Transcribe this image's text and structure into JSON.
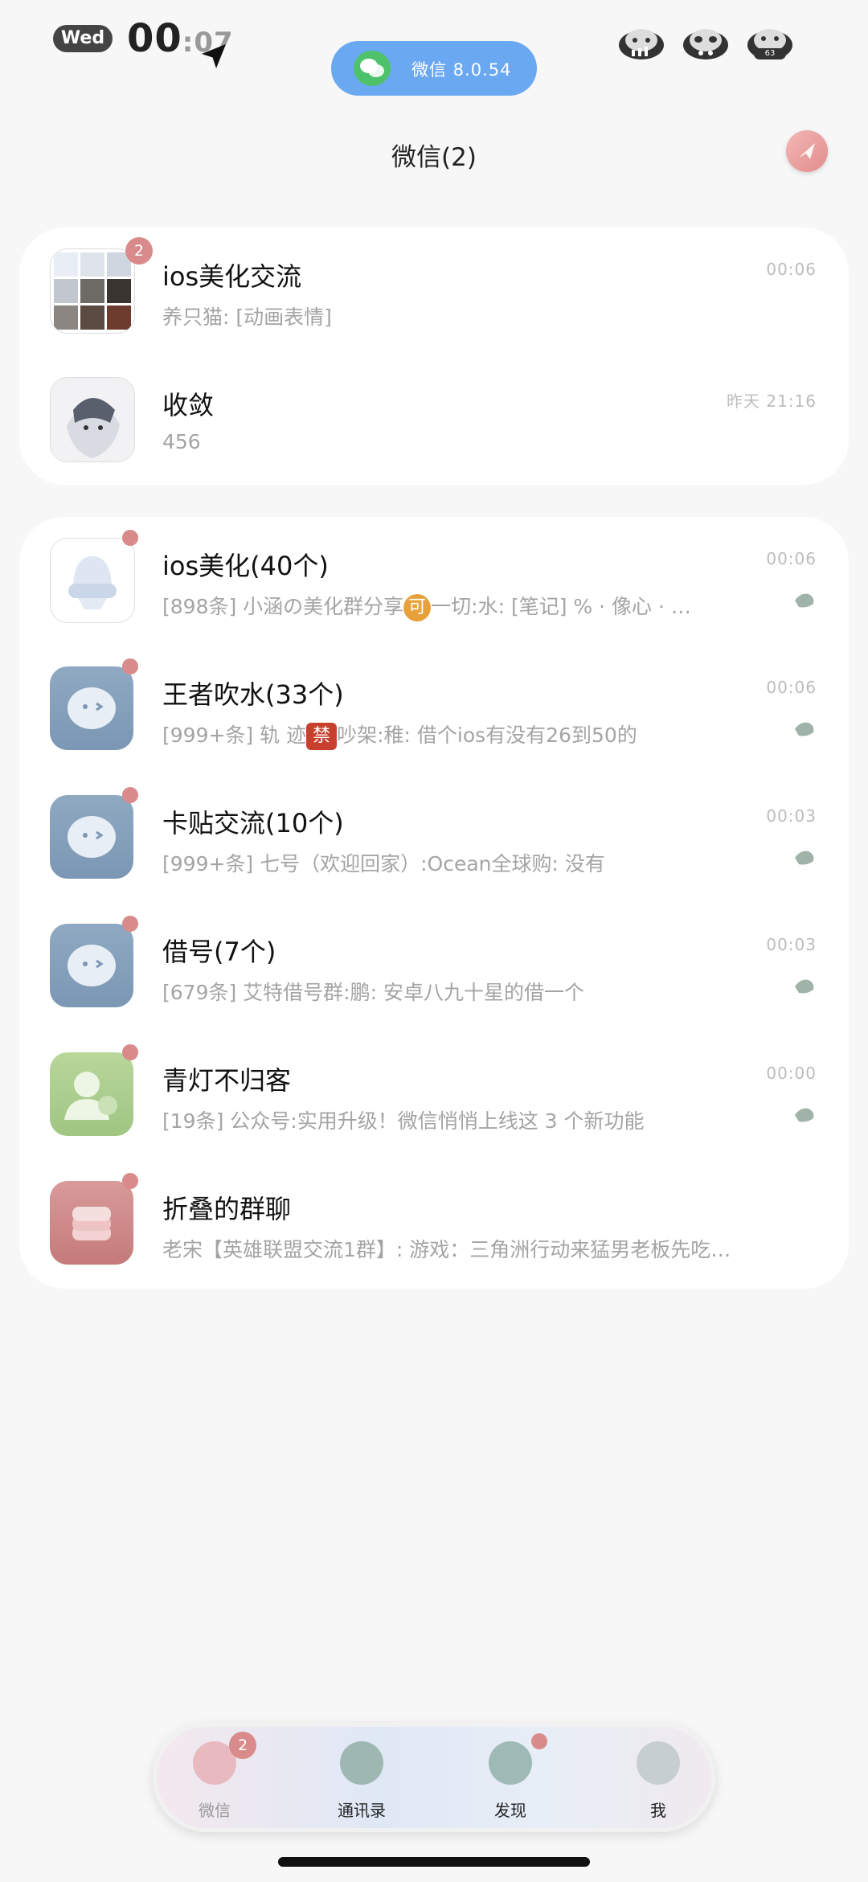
{
  "status_bar": {
    "day": "Wed",
    "time_main": "00",
    "time_seconds": ":07",
    "wechat_pill": "微信 8.0.54",
    "battery_label": "63"
  },
  "header": {
    "title": "微信(2)"
  },
  "pinned": [
    {
      "name": "ios美化交流",
      "preview": "养只猫: [动画表情]",
      "time": "00:06",
      "badge": "2"
    },
    {
      "name": "收敛",
      "preview": "456",
      "time": "昨天 21:16"
    }
  ],
  "chats": [
    {
      "name": "ios美化(40个)",
      "preview_a": "[898条] 小涵の美化群分享",
      "emoji": "可",
      "preview_b": "一切:水: [笔记] % · 像心 · …",
      "time": "00:06"
    },
    {
      "name": "王者吹水(33个)",
      "preview_a": "[999+条] 轨 迹",
      "emoji": "禁",
      "preview_b": "吵架:稚: 借个ios有没有26到50的",
      "time": "00:06"
    },
    {
      "name": "卡贴交流(10个)",
      "preview": "[999+条] 七号（欢迎回家）:Ocean全球购: 没有",
      "time": "00:03"
    },
    {
      "name": "借号(7个)",
      "preview": "[679条] 艾特借号群:鹏: 安卓八九十星的借一个",
      "time": "00:03"
    },
    {
      "name": "青灯不归客",
      "preview": "[19条] 公众号:实用升级！微信悄悄上线这 3 个新功能",
      "time": "00:00"
    },
    {
      "name": "折叠的群聊",
      "preview": "老宋【英雄联盟交流1群】: 游戏：三角洲行动来猛男老板先吃…"
    }
  ],
  "tabbar": {
    "wechat": "微信",
    "wechat_badge": "2",
    "contacts": "通讯录",
    "discover": "发现",
    "me": "我"
  },
  "colors": {
    "accent_red": "#d98a8a",
    "pill_blue": "#6aa8f2",
    "avatar_blue": "#8fa9c2"
  }
}
